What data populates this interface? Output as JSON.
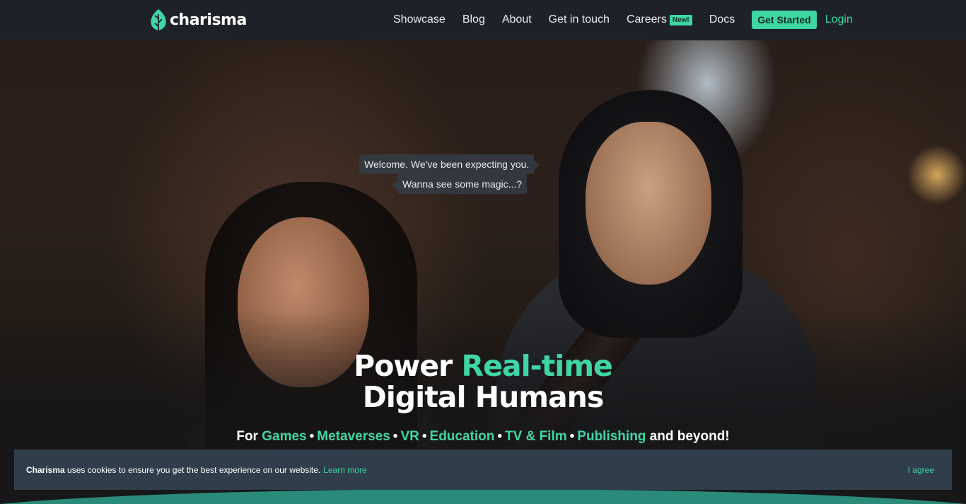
{
  "nav": {
    "brand": "charisma",
    "links": [
      "Showcase",
      "Blog",
      "About",
      "Get in touch"
    ],
    "careers": "Careers",
    "careers_badge": "New!",
    "docs": "Docs",
    "get_started": "Get Started",
    "login": "Login"
  },
  "hero": {
    "bubble_1": "Welcome. We've been expecting you.",
    "bubble_2": "Wanna see some magic...?",
    "headline_pre": "Power",
    "headline_accent": "Real-time",
    "headline_line2": "Digital Humans",
    "sub_pre": "For",
    "sub_items": [
      "Games",
      "Metaverses",
      "VR",
      "Education",
      "TV & Film",
      "Publishing"
    ],
    "sub_post": "and beyond!"
  },
  "cookie": {
    "brand": "Charisma",
    "text": " uses cookies to ensure you get the best experience on our website.",
    "learn_more": "Learn more",
    "agree": "I agree"
  },
  "colors": {
    "accent": "#3fd6a5",
    "nav_bg": "#1e2228",
    "cookie_bg": "#2f3e4a"
  }
}
